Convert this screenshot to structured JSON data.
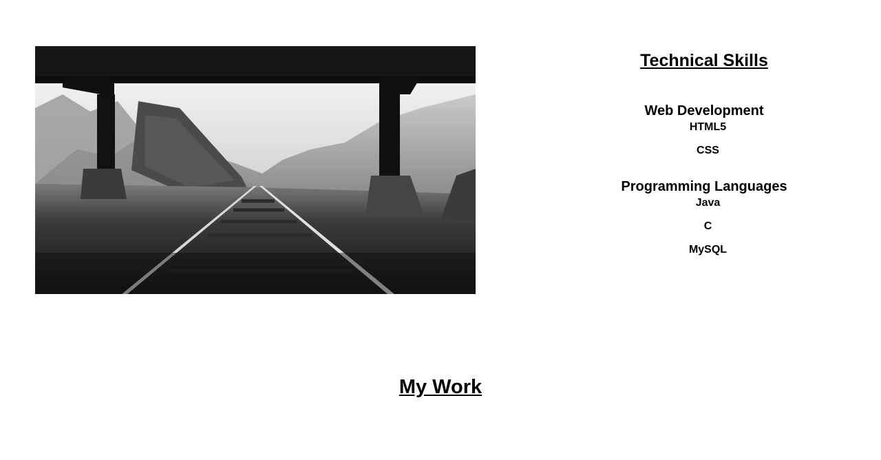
{
  "hero_image": {
    "subject": "black-and-white railroad tracks under a bridge"
  },
  "skills": {
    "title": "Technical Skills",
    "groups": [
      {
        "title": "Web Development",
        "items": [
          "HTML5",
          "CSS"
        ]
      },
      {
        "title": "Programming Languages",
        "items": [
          "Java",
          "C",
          "MySQL"
        ]
      }
    ]
  },
  "work": {
    "title": "My Work"
  }
}
